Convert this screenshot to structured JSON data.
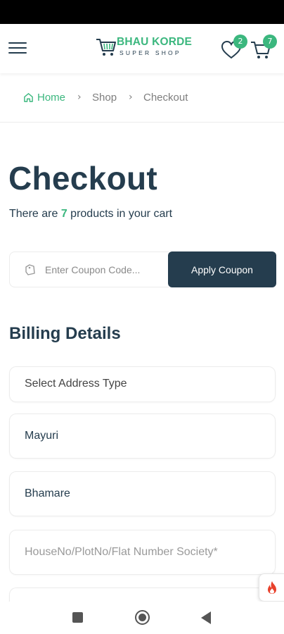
{
  "header": {
    "logo_title": "BHAU KORDE",
    "logo_subtitle": "SUPER SHOP",
    "wishlist_count": "2",
    "cart_count": "7"
  },
  "breadcrumb": {
    "items": [
      "Home",
      "Shop",
      "Checkout"
    ],
    "separator": "›"
  },
  "page": {
    "title": "Checkout",
    "cart_info_prefix": "There are ",
    "cart_info_count": "7",
    "cart_info_suffix": " products in your cart"
  },
  "coupon": {
    "placeholder": "Enter Coupon Code...",
    "button_label": "Apply Coupon"
  },
  "billing": {
    "title": "Billing Details",
    "address_type_label": "Select Address Type",
    "first_name_value": "Mayuri",
    "last_name_value": "Bhamare",
    "address_placeholder": "HouseNo/PlotNo/Flat Number  Society*"
  },
  "colors": {
    "accent": "#3bb77e",
    "dark": "#253d4e",
    "flame": "#e8412c"
  },
  "icons": {
    "menu": "hamburger-menu-icon",
    "wishlist": "heart-icon",
    "cart": "cart-icon",
    "home": "home-icon",
    "coupon": "tag-icon",
    "flame": "flame-icon"
  }
}
